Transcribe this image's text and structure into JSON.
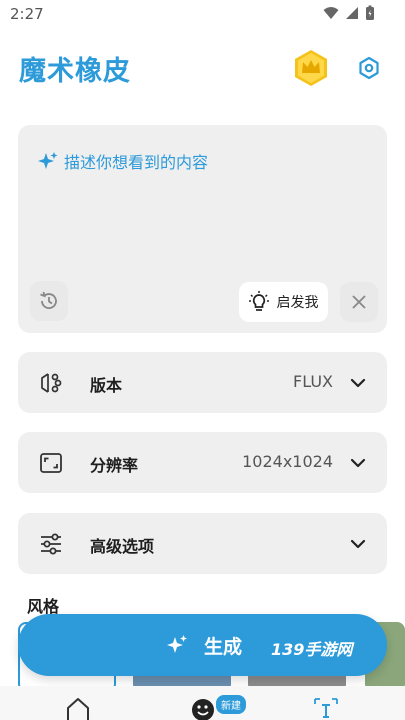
{
  "status_bar": {
    "time": "2:27"
  },
  "header": {
    "title": "魔术橡皮"
  },
  "prompt": {
    "hint": "描述你想看到的内容",
    "inspire_label": "启发我"
  },
  "options": [
    {
      "label": "版本",
      "value": "FLUX"
    },
    {
      "label": "分辨率",
      "value": "1024x1024"
    },
    {
      "label": "高级选项",
      "value": ""
    }
  ],
  "style_section": {
    "title": "风格"
  },
  "generate": {
    "label": "生成"
  },
  "watermark": "139手游网",
  "bottom_nav": {
    "new_badge": "新建"
  },
  "colors": {
    "accent": "#2d9ad9",
    "card": "#efefef",
    "crown": "#f5c21b"
  }
}
